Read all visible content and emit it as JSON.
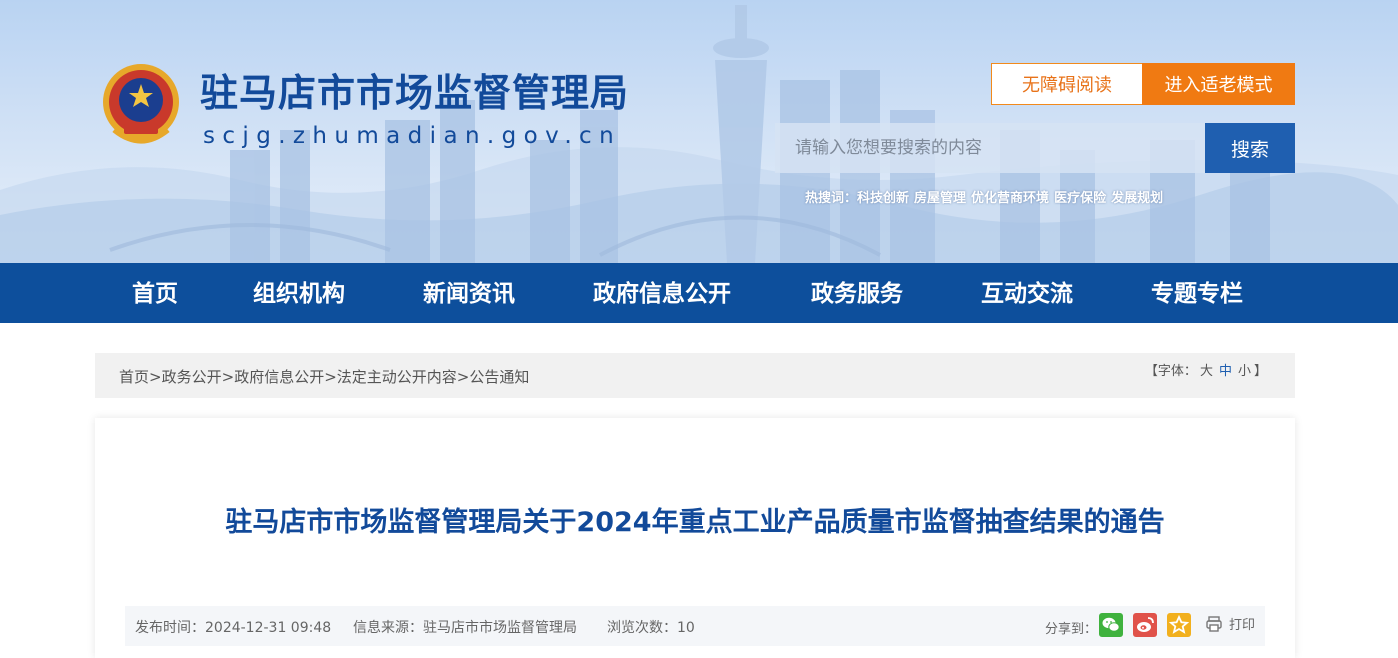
{
  "header": {
    "title": "驻马店市市场监督管理局",
    "domain": "scjg.zhumadian.gov.cn",
    "accessible_label": "无障碍阅读",
    "elder_mode_label": "进入适老模式",
    "search_placeholder": "请输入您想要搜索的内容",
    "search_button": "搜索",
    "hot_label": "热搜词：",
    "hot_words": [
      "科技创新",
      "房屋管理",
      "优化营商环境",
      "医疗保险",
      "发展规划"
    ]
  },
  "nav": {
    "items": [
      "首页",
      "组织机构",
      "新闻资讯",
      "政府信息公开",
      "政务服务",
      "互动交流",
      "专题专栏"
    ]
  },
  "breadcrumb": {
    "items": [
      "首页",
      "政务公开",
      "政府信息公开",
      "法定主动公开内容",
      "公告通知"
    ],
    "separator": ">"
  },
  "font_size": {
    "open": "【",
    "label": "字体：",
    "large": "大",
    "medium": "中",
    "small": "小",
    "close": "】"
  },
  "article": {
    "title": "驻马店市市场监督管理局关于2024年重点工业产品质量市监督抽查结果的通告",
    "publish_time": "发布时间：2024-12-31 09:48",
    "source": "信息来源：驻马店市市场监督管理局",
    "views": "浏览次数：10",
    "share_label": "分享到：",
    "print_label": "打印"
  },
  "colors": {
    "brand_blue": "#0d4f9c",
    "title_blue": "#124a9a",
    "accent_orange": "#f07a12",
    "search_blue": "#1f5fb0"
  },
  "icons": {
    "share": [
      "wechat-icon",
      "weibo-icon",
      "favorite-star-icon"
    ],
    "print": "printer-icon",
    "emblem": "police-emblem-icon"
  }
}
